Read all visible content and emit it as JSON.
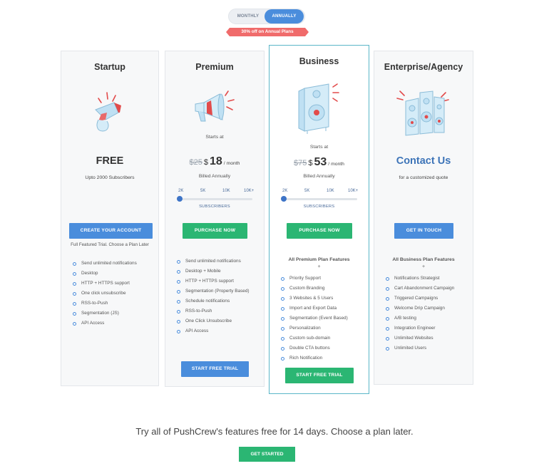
{
  "billing_toggle": {
    "monthly": "MONTHLY",
    "annually": "ANNUALLY",
    "selected": "annually"
  },
  "discount_ribbon": "30% off on Annual Plans",
  "plans": {
    "startup": {
      "title": "Startup",
      "price_text": "FREE",
      "subtitle": "Upto 2000 Subscribers",
      "cta": "CREATE YOUR ACCOUNT",
      "cta_note": "Full Featured Trial. Choose a Plan Later",
      "features": [
        "Send unlimited notifications",
        "Desktop",
        "HTTP + HTTPS support",
        "One click unsubscribe",
        "RSS-to-Push",
        "Segmentation (JS)",
        "API Access"
      ]
    },
    "premium": {
      "title": "Premium",
      "starts_at": "Starts at",
      "old_price": "$25",
      "currency": "$",
      "price": "18",
      "per": "/ month",
      "billed": "Billed Annually",
      "slider_ticks": [
        "2K",
        "5K",
        "10K",
        "10K+"
      ],
      "slider_label": "SUBSCRIBERS",
      "cta": "PURCHASE NOW",
      "features": [
        "Send unlimited notifications",
        "Desktop + Mobile",
        "HTTP + HTTPS support",
        "Segmentation (Property Based)",
        "Schedule notifications",
        "RSS-to-Push",
        "One Click Unsubscribe",
        "API Access"
      ],
      "trial": "START FREE TRIAL"
    },
    "business": {
      "title": "Business",
      "starts_at": "Starts at",
      "old_price": "$75",
      "currency": "$",
      "price": "53",
      "per": "/ month",
      "billed": "Billed Annually",
      "slider_ticks": [
        "2K",
        "5K",
        "10K",
        "10K+"
      ],
      "slider_label": "SUBSCRIBERS",
      "cta": "PURCHASE NOW",
      "features_heading": "All Premium Plan Features",
      "plus": "+",
      "features": [
        "Priority Support",
        "Custom Branding",
        "3 Websites & 5 Users",
        "Import and Export Data",
        "Segmentation (Event Based)",
        "Personalization",
        "Custom sub-domain",
        "Double CTA buttons",
        "Rich Notification"
      ],
      "trial": "START FREE TRIAL"
    },
    "enterprise": {
      "title": "Enterprise/Agency",
      "price_text": "Contact Us",
      "subtitle": "for a customized quote",
      "cta": "GET IN TOUCH",
      "features_heading": "All Business Plan Features",
      "plus": "+",
      "features": [
        "Notifications Strategist",
        "Cart Abandonment Campaign",
        "Triggered Campaigns",
        "Welcome Drip Campaign",
        "A/B testing",
        "Integration Engineer",
        "Unlimited Websites",
        "Unlimited Users"
      ]
    }
  },
  "footer": {
    "tagline": "Try all of PushCrew's features free for 14 days. Choose a plan later.",
    "cta": "GET STARTED"
  },
  "colors": {
    "blue": "#4a8ddc",
    "green": "#2bb673",
    "ribbon": "#f06b6b",
    "contact": "#3d74b8"
  }
}
